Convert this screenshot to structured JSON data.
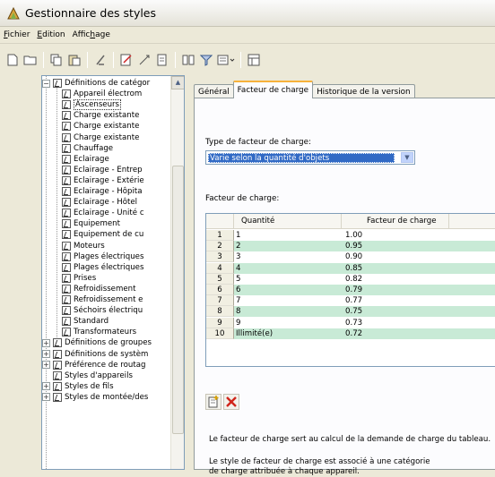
{
  "window": {
    "title": "Gestionnaire des styles",
    "icon": "style-manager-icon"
  },
  "menu": [
    {
      "label": "Fichier",
      "u": "F"
    },
    {
      "label": "Edition",
      "u": "E"
    },
    {
      "label": "Affichage",
      "u": "h"
    }
  ],
  "toolbar": {
    "icons": [
      "new-icon",
      "open-icon",
      "copy-icon",
      "paste-icon",
      "purge-icon",
      "edit-style-icon",
      "set-from-icon",
      "filter-style-icon",
      "toggle-view-icon",
      "filter-icon",
      "view-options-icon",
      "package-icon"
    ]
  },
  "tree": {
    "items": [
      {
        "label": "Définitions de catégor",
        "type": "folder",
        "expander": "−"
      },
      {
        "label": "Appareil électrom",
        "type": "leaf"
      },
      {
        "label": "Ascenseurs",
        "type": "leaf",
        "selected": true
      },
      {
        "label": "Charge existante",
        "type": "leaf"
      },
      {
        "label": "Charge existante",
        "type": "leaf"
      },
      {
        "label": "Charge existante",
        "type": "leaf"
      },
      {
        "label": "Chauffage",
        "type": "leaf"
      },
      {
        "label": "Eclairage",
        "type": "leaf"
      },
      {
        "label": "Eclairage - Entrep",
        "type": "leaf"
      },
      {
        "label": "Eclairage - Extérie",
        "type": "leaf"
      },
      {
        "label": "Eclairage - Hôpita",
        "type": "leaf"
      },
      {
        "label": "Eclairage - Hôtel",
        "type": "leaf"
      },
      {
        "label": "Eclairage - Unité c",
        "type": "leaf"
      },
      {
        "label": "Equipement",
        "type": "leaf"
      },
      {
        "label": "Equipement de cu",
        "type": "leaf"
      },
      {
        "label": "Moteurs",
        "type": "leaf"
      },
      {
        "label": "Plages électriques",
        "type": "leaf"
      },
      {
        "label": "Plages électriques",
        "type": "leaf"
      },
      {
        "label": "Prises",
        "type": "leaf"
      },
      {
        "label": "Refroidissement",
        "type": "leaf"
      },
      {
        "label": "Refroidissement e",
        "type": "leaf"
      },
      {
        "label": "Séchoirs électriqu",
        "type": "leaf"
      },
      {
        "label": "Standard",
        "type": "leaf"
      },
      {
        "label": "Transformateurs",
        "type": "leaf"
      },
      {
        "label": "Définitions de groupes",
        "type": "folder",
        "expander": "+"
      },
      {
        "label": "Définitions de systèm",
        "type": "folder",
        "expander": "+"
      },
      {
        "label": "Préférence de routag",
        "type": "folder",
        "expander": "+"
      },
      {
        "label": "Styles d'appareils",
        "type": "folder",
        "expander": ""
      },
      {
        "label": "Styles de fils",
        "type": "folder",
        "expander": "+"
      },
      {
        "label": "Styles de montée/des",
        "type": "folder",
        "expander": "+"
      }
    ]
  },
  "tabs": [
    {
      "label": "Général",
      "active": false
    },
    {
      "label": "Facteur de charge",
      "active": true
    },
    {
      "label": "Historique de la version",
      "active": false
    }
  ],
  "panel": {
    "type_label": "Type de facteur de charge:",
    "type_value": "Varie selon la quantité d'objets",
    "factor_label": "Facteur de charge:",
    "columns": [
      "Quantité",
      "Facteur de charge"
    ],
    "rows": [
      {
        "n": "1",
        "q": "1",
        "f": "1.00"
      },
      {
        "n": "2",
        "q": "2",
        "f": "0.95"
      },
      {
        "n": "3",
        "q": "3",
        "f": "0.90"
      },
      {
        "n": "4",
        "q": "4",
        "f": "0.85"
      },
      {
        "n": "5",
        "q": "5",
        "f": "0.82"
      },
      {
        "n": "6",
        "q": "6",
        "f": "0.79"
      },
      {
        "n": "7",
        "q": "7",
        "f": "0.77"
      },
      {
        "n": "8",
        "q": "8",
        "f": "0.75"
      },
      {
        "n": "9",
        "q": "9",
        "f": "0.73"
      },
      {
        "n": "10",
        "q": "Illimité(e)",
        "f": "0.72"
      }
    ],
    "desc1": "Le facteur de charge sert au calcul de la demande de charge du tableau.",
    "desc2a": "Le style de facteur de charge est associé à une catégorie",
    "desc2b": "de charge attribuée à chaque appareil."
  },
  "colors": {
    "alt_row": "#c8ead6",
    "selection": "#316ac5",
    "tab_accent": "#f7b13b"
  }
}
